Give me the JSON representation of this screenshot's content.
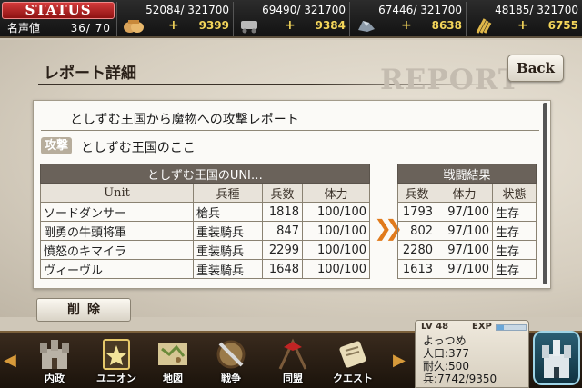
{
  "status": {
    "label": "STATUS",
    "fame_label": "名声値",
    "fame_value": "36/ 70"
  },
  "resources": [
    {
      "name": "food",
      "icon": "rice-bag-icon",
      "amount": "52084/ 321700",
      "plus": "+",
      "rate": "9399"
    },
    {
      "name": "stone",
      "icon": "stone-cart-icon",
      "amount": "69490/ 321700",
      "plus": "+",
      "rate": "9384"
    },
    {
      "name": "iron",
      "icon": "iron-ore-icon",
      "amount": "67446/ 321700",
      "plus": "+",
      "rate": "8638"
    },
    {
      "name": "grain",
      "icon": "wheat-icon",
      "amount": "48185/ 321700",
      "plus": "+",
      "rate": "6755"
    }
  ],
  "header": {
    "title": "レポート詳細",
    "watermark": "REPORT",
    "back_label": "Back"
  },
  "report": {
    "title": "としずむ王国から魔物への攻撃レポート",
    "attack_badge": "攻撃",
    "attack_target": "としずむ王国のここ",
    "unit_table": {
      "caption": "としずむ王国のUNI…",
      "headers": [
        "Unit",
        "兵種",
        "兵数",
        "体力"
      ],
      "rows": [
        [
          "ソードダンサー",
          "槍兵",
          "1818",
          "100/100"
        ],
        [
          "剛勇の牛頭将軍",
          "重装騎兵",
          "847",
          "100/100"
        ],
        [
          "憤怒のキマイラ",
          "重装騎兵",
          "2299",
          "100/100"
        ],
        [
          "ヴィーヴル",
          "重装騎兵",
          "1648",
          "100/100"
        ]
      ]
    },
    "result_table": {
      "caption": "戦闘結果",
      "headers": [
        "兵数",
        "体力",
        "状態"
      ],
      "rows": [
        [
          "1793",
          "97/100",
          "生存"
        ],
        [
          "802",
          "97/100",
          "生存"
        ],
        [
          "2280",
          "97/100",
          "生存"
        ],
        [
          "1613",
          "97/100",
          "生存"
        ]
      ]
    },
    "delete_label": "削除"
  },
  "nav": {
    "items": [
      {
        "label": "内政",
        "icon": "castle-icon"
      },
      {
        "label": "ユニオン",
        "icon": "union-card-icon"
      },
      {
        "label": "地図",
        "icon": "map-scroll-icon"
      },
      {
        "label": "戦争",
        "icon": "shield-sword-icon"
      },
      {
        "label": "同盟",
        "icon": "alliance-flag-icon"
      },
      {
        "label": "クエスト",
        "icon": "quest-scroll-icon"
      }
    ]
  },
  "player": {
    "level_label": "LV 48",
    "exp_label": "EXP",
    "exp_fraction": 0.25,
    "name": "よっつめ",
    "population": "人口:377",
    "durability": "耐久:500",
    "troops": "兵:7742/9350"
  },
  "colors": {
    "status_red": "#c02424",
    "rate_yellow": "#f3d55a",
    "arrow_orange": "#e07a1c",
    "table_caption": "#6a625a"
  }
}
